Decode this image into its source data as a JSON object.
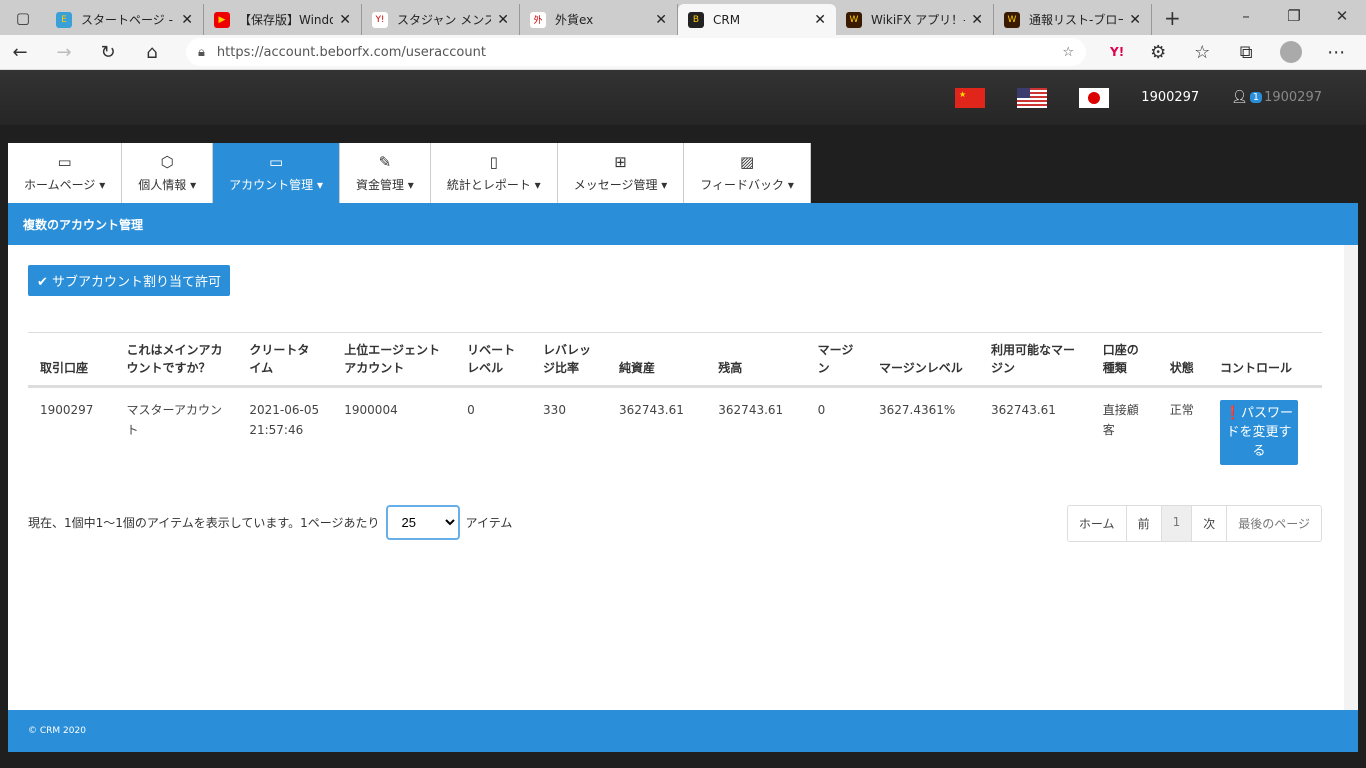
{
  "browser": {
    "tabs": [
      {
        "title": "スタートページ - E ST",
        "color": "#3aa0d8",
        "glyph": "E"
      },
      {
        "title": "【保存版】Windows",
        "color": "#e00",
        "glyph": "▶"
      },
      {
        "title": "スタジャン メンズの商",
        "color": "#fff",
        "glyph": "Y!"
      },
      {
        "title": "外貨ex",
        "color": "#fff",
        "glyph": "外"
      },
      {
        "title": "CRM",
        "color": "#222",
        "glyph": "B"
      },
      {
        "title": "WikiFX アプリ！- ク",
        "color": "#3a1a00",
        "glyph": "W"
      },
      {
        "title": "通報リスト-ブローカー",
        "color": "#3a1a00",
        "glyph": "W"
      }
    ],
    "url": "https://account.beborfx.com/useraccount"
  },
  "header": {
    "user_id": "1900297",
    "notif_count": "1",
    "username": "1900297"
  },
  "nav": [
    {
      "label": "ホームページ",
      "icon": "▭"
    },
    {
      "label": "個人情報",
      "icon": "⬡"
    },
    {
      "label": "アカウント管理",
      "icon": "▭"
    },
    {
      "label": "資金管理",
      "icon": "✎"
    },
    {
      "label": "統計とレポート",
      "icon": "▯"
    },
    {
      "label": "メッセージ管理",
      "icon": "⊞"
    },
    {
      "label": "フィードバック",
      "icon": "▨"
    }
  ],
  "panel": {
    "title": "複数のアカウント管理",
    "allow_button": "サブアカウント割り当て許可"
  },
  "table": {
    "headers": [
      "取引口座",
      "これはメインアカウントですか？",
      "クリートタイム",
      "上位エージェントアカウント",
      "リベートレベル",
      "レバレッジ比率",
      "純資産",
      "残高",
      "マージン",
      "マージンレベル",
      "利用可能なマージン",
      "口座の種類",
      "状態",
      "コントロール"
    ],
    "rows": [
      [
        "1900297",
        "マスターアカウント",
        "2021-06-05 21:57:46",
        "1900004",
        "0",
        "330",
        "362743.61",
        "362743.61",
        "0",
        "3627.4361%",
        "362743.61",
        "直接顧客",
        "正常"
      ]
    ],
    "action": "パスワードを変更する"
  },
  "footer_info": {
    "text": "現在、1個中1〜1個のアイテムを表示しています。1ページあたり",
    "per_page": "25",
    "suffix": "アイテム"
  },
  "pager": [
    "ホーム",
    "前",
    "1",
    "次",
    "最後のページ"
  ],
  "footer": "© CRM 2020"
}
